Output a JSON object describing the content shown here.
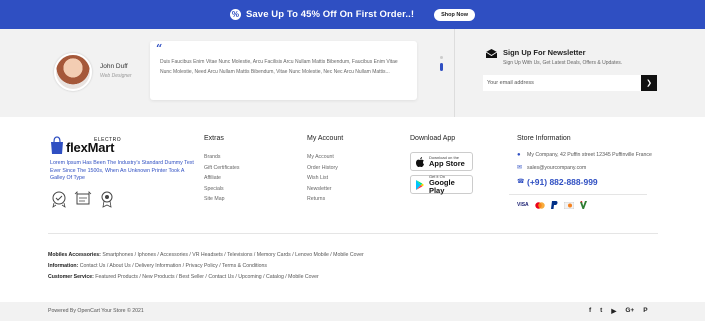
{
  "promo": {
    "badge": "%",
    "text": "Save Up To 45% Off On First Order..!",
    "button": "Shop Now"
  },
  "testimonial": {
    "name": "John Duff",
    "role": "Web Designer",
    "quote_mark": "“",
    "text": "Duis Faucibus Enim Vitae Nunc Molestie, Arcu Facilisis Arcu Nullam Mattis Bibendum, Faucibus Enim Vitae Nunc Molestie, Need Arcu Nullam Mattis Bibendum, Vitae Nunc Molestie, Nec Nec Arcu Nullam Mattis..."
  },
  "newsletter": {
    "title": "Sign Up For Newsletter",
    "subtitle": "Sign Up With Us, Get Latest Deals, Offers & Updates.",
    "placeholder": "Your email address",
    "button_icon": "❯"
  },
  "brand": {
    "logo_flex": "flexMart",
    "logo_electro": "ELECTRO",
    "about": "Lorem Ipsum Has Been The Industry's Standard Dummy Text Ever Since The 1500s, When An Unknown Printer Took A Galley Of Type"
  },
  "extras": {
    "title": "Extras",
    "links": [
      "Brands",
      "Gift Certificates",
      "Affiliate",
      "Specials",
      "Site Map"
    ]
  },
  "account": {
    "title": "My Account",
    "links": [
      "My Account",
      "Order History",
      "Wish List",
      "Newsletter",
      "Returns"
    ]
  },
  "download": {
    "title": "Download App",
    "app_store": {
      "small": "Download on the",
      "big": "App Store"
    },
    "google_play": {
      "small": "Get it On",
      "big": "Google Play"
    }
  },
  "store": {
    "title": "Store Information",
    "address": "My Company, 42 Puffin street 12345 Puffinville France",
    "email": "sales@yourcompany.com",
    "phone": "(+91) 882-888-999",
    "payments": [
      "VISA",
      "mastercard",
      "paypal",
      "discover",
      "card"
    ]
  },
  "links_rows": [
    {
      "label": "Mobiles Accessories:",
      "items": "Smartphones / Iphones / Accessories / VR Headsets / Televisions / Memory Cards / Lenovo Mobile / Mobile Cover"
    },
    {
      "label": "Information:",
      "items": "Contact Us / About Us / Delivery Information / Privacy Policy / Terms & Conditions"
    },
    {
      "label": "Customer Service:",
      "items": "Featured Products / New Products / Best Seller / Contact Us / Upcoming / Catalog / Mobile Cover"
    }
  ],
  "footer": {
    "powered": "Powered By OpenCart Your Store © 2021",
    "social": [
      "f",
      "t",
      "▶",
      "G+",
      "P"
    ]
  },
  "colors": {
    "accent": "#2f4fc2",
    "band": "#f2f2f2"
  }
}
